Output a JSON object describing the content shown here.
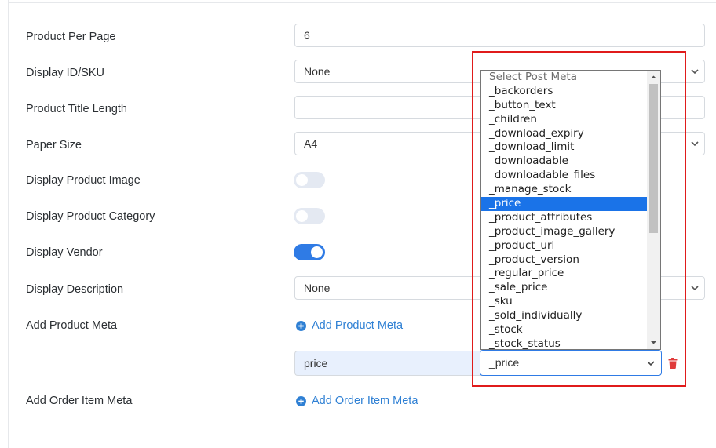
{
  "settings": {
    "product_per_page": {
      "label": "Product Per Page",
      "value": "6"
    },
    "display_id_sku": {
      "label": "Display ID/SKU",
      "value": "None"
    },
    "product_title_length": {
      "label": "Product Title Length",
      "value": ""
    },
    "paper_size": {
      "label": "Paper Size",
      "value": "A4"
    },
    "display_product_image": {
      "label": "Display Product Image",
      "enabled": false
    },
    "display_product_category": {
      "label": "Display Product Category",
      "enabled": false
    },
    "display_vendor": {
      "label": "Display Vendor",
      "enabled": true
    },
    "display_description": {
      "label": "Display Description",
      "value": "None"
    },
    "add_product_meta": {
      "label": "Add Product Meta",
      "link_label": "Add Product Meta",
      "row": {
        "name_value": "price",
        "meta_value": "_price"
      }
    },
    "add_order_item_meta": {
      "label": "Add Order Item Meta",
      "link_label": "Add Order Item Meta"
    }
  },
  "dropdown": {
    "placeholder": "Select Post Meta",
    "selected": "_price",
    "options": [
      "_backorders",
      "_button_text",
      "_children",
      "_download_expiry",
      "_download_limit",
      "_downloadable",
      "_downloadable_files",
      "_manage_stock",
      "_price",
      "_product_attributes",
      "_product_image_gallery",
      "_product_url",
      "_product_version",
      "_regular_price",
      "_sale_price",
      "_sku",
      "_sold_individually",
      "_stock",
      "_stock_status"
    ]
  },
  "colors": {
    "accent": "#2f7be5",
    "link": "#2f80d4",
    "highlight_border": "#e01b1b",
    "selected_option": "#1a73e8",
    "delete_icon": "#e03b3b"
  },
  "icons": {
    "add": "plus-circle-icon",
    "delete": "trash-icon",
    "select": "chevron-down-icon"
  }
}
